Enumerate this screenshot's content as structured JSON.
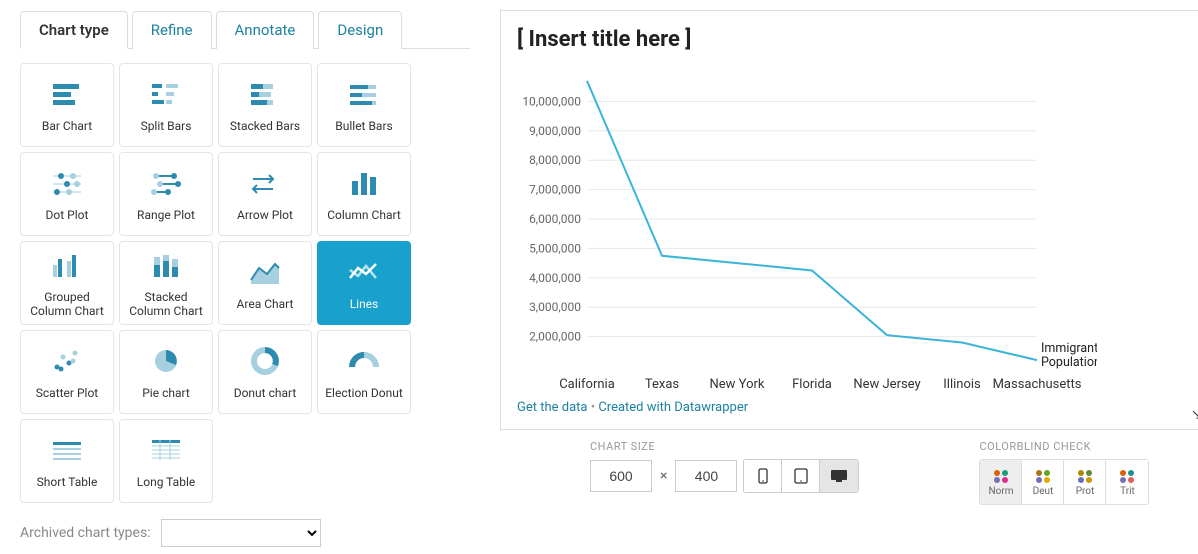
{
  "tabs": [
    {
      "label": "Chart type",
      "active": true
    },
    {
      "label": "Refine",
      "active": false
    },
    {
      "label": "Annotate",
      "active": false
    },
    {
      "label": "Design",
      "active": false
    }
  ],
  "chart_types": [
    {
      "id": "bar-chart",
      "label": "Bar Chart"
    },
    {
      "id": "split-bars",
      "label": "Split Bars"
    },
    {
      "id": "stacked-bars",
      "label": "Stacked Bars"
    },
    {
      "id": "bullet-bars",
      "label": "Bullet Bars"
    },
    {
      "id": "dot-plot",
      "label": "Dot Plot"
    },
    {
      "id": "range-plot",
      "label": "Range Plot"
    },
    {
      "id": "arrow-plot",
      "label": "Arrow Plot"
    },
    {
      "id": "column-chart",
      "label": "Column Chart"
    },
    {
      "id": "grouped-column",
      "label": "Grouped Column Chart"
    },
    {
      "id": "stacked-column",
      "label": "Stacked Column Chart"
    },
    {
      "id": "area-chart",
      "label": "Area Chart"
    },
    {
      "id": "lines",
      "label": "Lines",
      "selected": true
    },
    {
      "id": "scatter-plot",
      "label": "Scatter Plot"
    },
    {
      "id": "pie-chart",
      "label": "Pie chart"
    },
    {
      "id": "donut-chart",
      "label": "Donut chart"
    },
    {
      "id": "election-donut",
      "label": "Election Donut"
    },
    {
      "id": "short-table",
      "label": "Short Table"
    },
    {
      "id": "long-table",
      "label": "Long Table"
    }
  ],
  "archived_label": "Archived chart types:",
  "preview": {
    "title": "[ Insert title here ]",
    "footer_get_data": "Get the data",
    "footer_sep": " • ",
    "footer_credit": "Created with Datawrapper",
    "series_label": "Immigrant Population"
  },
  "chart_data": {
    "type": "line",
    "title": "[ Insert title here ]",
    "xlabel": "",
    "ylabel": "",
    "ylim": [
      1000000,
      11000000
    ],
    "y_ticks": [
      2000000,
      3000000,
      4000000,
      5000000,
      6000000,
      7000000,
      8000000,
      9000000,
      10000000
    ],
    "y_tick_labels": [
      "2,000,000",
      "3,000,000",
      "4,000,000",
      "5,000,000",
      "6,000,000",
      "7,000,000",
      "8,000,000",
      "9,000,000",
      "10,000,000"
    ],
    "categories": [
      "California",
      "Texas",
      "New York",
      "Florida",
      "New Jersey",
      "Illinois",
      "Massachusetts"
    ],
    "series": [
      {
        "name": "Immigrant Population",
        "values": [
          10700000,
          4750000,
          4500000,
          4250000,
          2050000,
          1800000,
          1200000
        ]
      }
    ]
  },
  "chart_size": {
    "title": "CHART SIZE",
    "width": "600",
    "height": "400",
    "sep": "×"
  },
  "colorblind": {
    "title": "COLORBLIND CHECK",
    "modes": [
      "Norm",
      "Deut",
      "Prot",
      "Trit"
    ],
    "active": "Norm"
  },
  "devices": {
    "options": [
      "mobile",
      "tablet",
      "desktop"
    ],
    "active": "desktop"
  }
}
